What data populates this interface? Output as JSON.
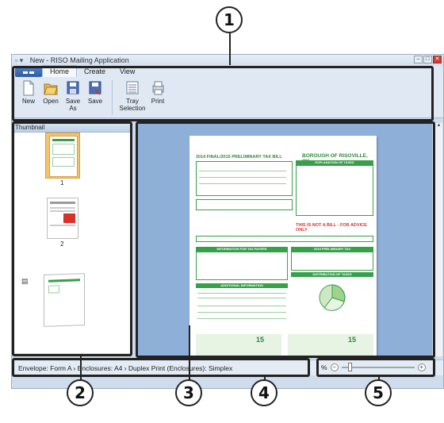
{
  "window": {
    "title": "New - RISO Mailing Application"
  },
  "ribbon": {
    "tabs": [
      "Home",
      "Create",
      "View"
    ],
    "commands": {
      "new": "New",
      "open": "Open",
      "save_as": "Save\nAs",
      "save": "Save",
      "tray_selection": "Tray\nSelection",
      "print": "Print"
    }
  },
  "thumbnail_pane": {
    "header": "Thumbnail",
    "pages": [
      "1",
      "2"
    ]
  },
  "status_bar": {
    "text": "Envelope: Form A › Enclosures: A4 › Duplex Print (Enclosures): Simplex"
  },
  "zoom": {
    "label": "%"
  },
  "callouts": [
    "1",
    "2",
    "3",
    "4",
    "5"
  ],
  "document": {
    "title": "2014 FINAL/2015 PRELIMINARY TAX BILL",
    "borough": "BOROUGH OF RISOVILLE, OK",
    "explanation": "EXPLANATION OF TAXES",
    "not_a_bill": "THIS IS NOT A BILL - FOR ADVICE ONLY",
    "info": "INFORMATION FOR TAX PAYERS",
    "prelim": "2015 PRELIMINARY TAX",
    "distribution": "DISTRIBUTION OF TAXES",
    "additional": "ADDITIONAL INFORMATION",
    "footer_number": "15"
  }
}
